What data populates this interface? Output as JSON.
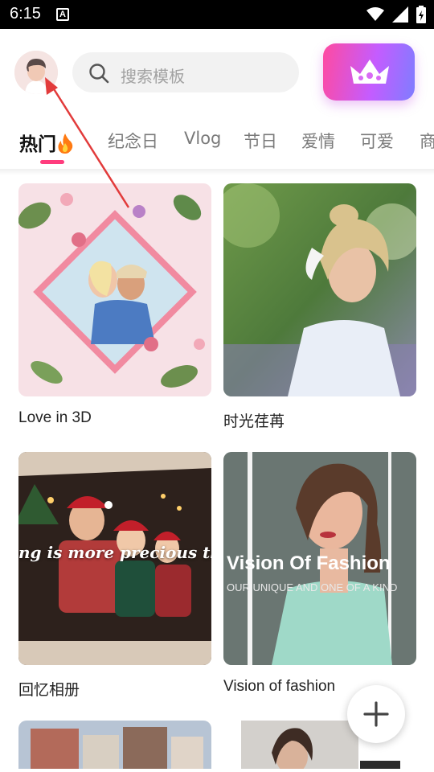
{
  "status_bar": {
    "time": "6:15",
    "notification_badge": "A"
  },
  "header": {
    "search_placeholder": "搜索模板",
    "vip_icon": "crown-icon"
  },
  "tabs": [
    {
      "label": "热门"
    },
    {
      "label": "纪念日"
    },
    {
      "label": "Vlog"
    },
    {
      "label": "节日"
    },
    {
      "label": "爱情"
    },
    {
      "label": "可爱"
    },
    {
      "label": "商"
    }
  ],
  "templates": [
    {
      "title": "Love in 3D"
    },
    {
      "title": "时光荏苒"
    },
    {
      "title": "回忆相册",
      "overlay_text": "ng is more precious than"
    },
    {
      "title": "Vision of  fashion",
      "overlay_title": "Vision Of Fashion",
      "overlay_sub": "OUR UNIQUE AND ONE OF A KIND"
    }
  ],
  "fab": {
    "label": "+"
  },
  "colors": {
    "accent": "#ff3c7d",
    "vip_start": "#ff4aa0",
    "vip_end": "#7f7dff",
    "annotation_arrow": "#e23b3b"
  }
}
